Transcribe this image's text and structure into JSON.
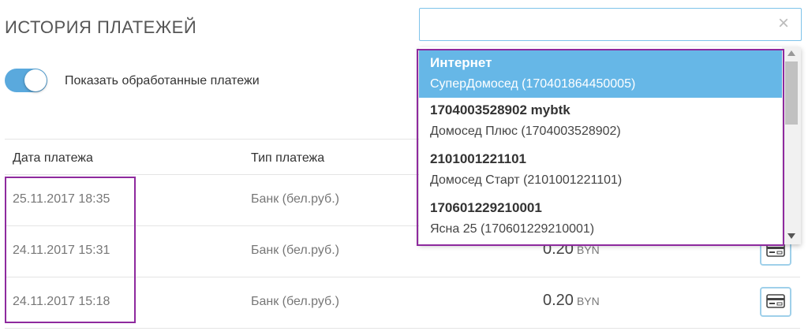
{
  "header": {
    "title": "ИСТОРИЯ ПЛАТЕЖЕЙ"
  },
  "toggle": {
    "label": "Показать обработанные платежи",
    "on": true
  },
  "search": {
    "value": "",
    "placeholder": "",
    "clear_glyph": "×"
  },
  "table": {
    "headers": {
      "date": "Дата платежа",
      "type": "Тип платежа"
    },
    "rows": [
      {
        "date": "25.11.2017 18:35",
        "type": "Банк (бел.руб.)",
        "amount": "",
        "currency": ""
      },
      {
        "date": "24.11.2017 15:31",
        "type": "Банк (бел.руб.)",
        "amount": "0.20",
        "currency": "BYN"
      },
      {
        "date": "24.11.2017 15:18",
        "type": "Банк (бел.руб.)",
        "amount": "0.20",
        "currency": "BYN"
      }
    ]
  },
  "dropdown": {
    "items": [
      {
        "title": "Интернет",
        "subtitle": "СуперДомосед (170401864450005)",
        "selected": true
      },
      {
        "title": "1704003528902 mybtk",
        "subtitle": "Домосед Плюс (1704003528902)",
        "selected": false
      },
      {
        "title": "2101001221101",
        "subtitle": "Домосед Старт (2101001221101)",
        "selected": false
      },
      {
        "title": "170601229210001",
        "subtitle": "Ясна 25 (170601229210001)",
        "selected": false
      }
    ]
  },
  "colors": {
    "accent": "#5aa9dd",
    "selected": "#66b7e7",
    "highlight": "#8e2a9e"
  }
}
